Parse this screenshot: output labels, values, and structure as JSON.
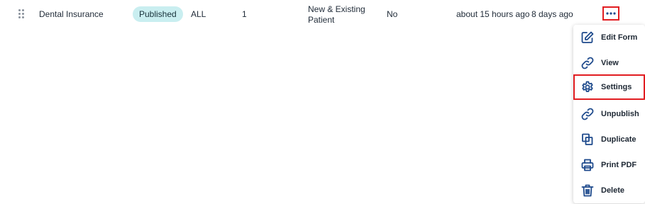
{
  "row": {
    "name": "Dental Insurance",
    "status": "Published",
    "audience": "ALL",
    "count": "1",
    "patient_type_line1": "New & Existing",
    "patient_type_line2": "Patient",
    "flag": "No",
    "updated": "about 15 hours ago",
    "created": "8 days ago"
  },
  "menu": {
    "items": [
      {
        "label": "Edit Form",
        "icon": "edit-icon"
      },
      {
        "label": "View",
        "icon": "link-icon"
      },
      {
        "label": "Settings",
        "icon": "gear-icon"
      },
      {
        "label": "Unpublish",
        "icon": "link-icon"
      },
      {
        "label": "Duplicate",
        "icon": "copy-icon"
      },
      {
        "label": "Print PDF",
        "icon": "printer-icon"
      },
      {
        "label": "Delete",
        "icon": "trash-icon"
      }
    ]
  },
  "colors": {
    "badge_bg": "#c9eef0",
    "icon": "#1e4a8c",
    "highlight": "#e11d21"
  }
}
